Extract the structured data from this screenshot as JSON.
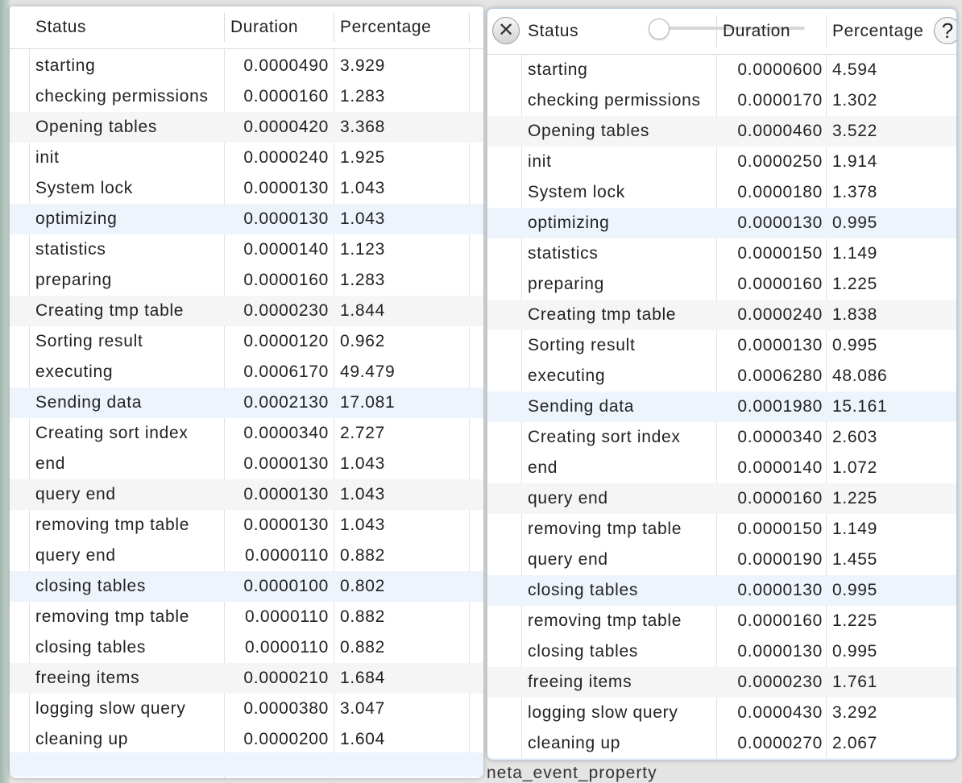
{
  "left_table": {
    "columns": [
      "Status",
      "Duration",
      "Percentage"
    ],
    "rows": [
      [
        "starting",
        "0.0000490",
        "3.929"
      ],
      [
        "checking permissions",
        "0.0000160",
        "1.283"
      ],
      [
        "Opening tables",
        "0.0000420",
        "3.368"
      ],
      [
        "init",
        "0.0000240",
        "1.925"
      ],
      [
        "System lock",
        "0.0000130",
        "1.043"
      ],
      [
        "optimizing",
        "0.0000130",
        "1.043"
      ],
      [
        "statistics",
        "0.0000140",
        "1.123"
      ],
      [
        "preparing",
        "0.0000160",
        "1.283"
      ],
      [
        "Creating tmp table",
        "0.0000230",
        "1.844"
      ],
      [
        "Sorting result",
        "0.0000120",
        "0.962"
      ],
      [
        "executing",
        "0.0006170",
        "49.479"
      ],
      [
        "Sending data",
        "0.0002130",
        "17.081"
      ],
      [
        "Creating sort index",
        "0.0000340",
        "2.727"
      ],
      [
        "end",
        "0.0000130",
        "1.043"
      ],
      [
        "query end",
        "0.0000130",
        "1.043"
      ],
      [
        "removing tmp table",
        "0.0000130",
        "1.043"
      ],
      [
        "query end",
        "0.0000110",
        "0.882"
      ],
      [
        "closing tables",
        "0.0000100",
        "0.802"
      ],
      [
        "removing tmp table",
        "0.0000110",
        "0.882"
      ],
      [
        "closing tables",
        "0.0000110",
        "0.882"
      ],
      [
        "freeing items",
        "0.0000210",
        "1.684"
      ],
      [
        "logging slow query",
        "0.0000380",
        "3.047"
      ],
      [
        "cleaning up",
        "0.0000200",
        "1.604"
      ]
    ]
  },
  "right_table": {
    "columns": [
      "Status",
      "Duration",
      "Percentage"
    ],
    "rows": [
      [
        "starting",
        "0.0000600",
        "4.594"
      ],
      [
        "checking permissions",
        "0.0000170",
        "1.302"
      ],
      [
        "Opening tables",
        "0.0000460",
        "3.522"
      ],
      [
        "init",
        "0.0000250",
        "1.914"
      ],
      [
        "System lock",
        "0.0000180",
        "1.378"
      ],
      [
        "optimizing",
        "0.0000130",
        "0.995"
      ],
      [
        "statistics",
        "0.0000150",
        "1.149"
      ],
      [
        "preparing",
        "0.0000160",
        "1.225"
      ],
      [
        "Creating tmp table",
        "0.0000240",
        "1.838"
      ],
      [
        "Sorting result",
        "0.0000130",
        "0.995"
      ],
      [
        "executing",
        "0.0006280",
        "48.086"
      ],
      [
        "Sending data",
        "0.0001980",
        "15.161"
      ],
      [
        "Creating sort index",
        "0.0000340",
        "2.603"
      ],
      [
        "end",
        "0.0000140",
        "1.072"
      ],
      [
        "query end",
        "0.0000160",
        "1.225"
      ],
      [
        "removing tmp table",
        "0.0000150",
        "1.149"
      ],
      [
        "query end",
        "0.0000190",
        "1.455"
      ],
      [
        "closing tables",
        "0.0000130",
        "0.995"
      ],
      [
        "removing tmp table",
        "0.0000160",
        "1.225"
      ],
      [
        "closing tables",
        "0.0000130",
        "0.995"
      ],
      [
        "freeing items",
        "0.0000230",
        "1.761"
      ],
      [
        "logging slow query",
        "0.0000430",
        "3.292"
      ],
      [
        "cleaning up",
        "0.0000270",
        "2.067"
      ]
    ],
    "close_icon": "✕",
    "help_icon": "?"
  },
  "background_text": "neta_event_property"
}
